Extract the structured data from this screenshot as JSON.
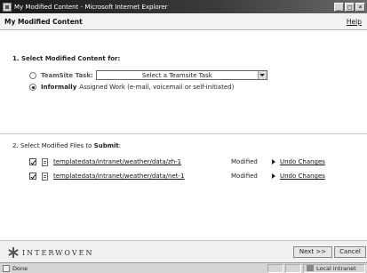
{
  "window": {
    "title": "My Modified Content - Microsoft Internet Explorer",
    "buttons": {
      "minimize": "_",
      "maximize": "□",
      "close": "×"
    }
  },
  "header": {
    "title": "My Modified Content",
    "help": "Help"
  },
  "section1": {
    "title": "1. Select Modified Content for:",
    "teamsite": {
      "label": "TeamSite Task:",
      "selected": false,
      "select_value": "Select a Teamsite Task"
    },
    "informal": {
      "label_bold": "Informally",
      "label_rest": "Assigned Work (e-mail, voicemail or self-initiated)",
      "selected": true
    }
  },
  "section2": {
    "title_prefix": "2. Select Modified Files to",
    "title_bold": "Submit",
    "title_suffix": ":",
    "files": [
      {
        "path": "templatedata/intranet/weather/data/zh-1",
        "checked": true,
        "status": "Modified",
        "action": "Undo Changes"
      },
      {
        "path": "templatedata/intranet/weather/data/net-1",
        "checked": true,
        "status": "Modified",
        "action": "Undo Changes"
      }
    ]
  },
  "footer": {
    "logo": "INTERWOVEN",
    "next": "Next >>",
    "cancel": "Cancel"
  },
  "statusbar": {
    "status": "Done",
    "zone": "Local intranet"
  }
}
